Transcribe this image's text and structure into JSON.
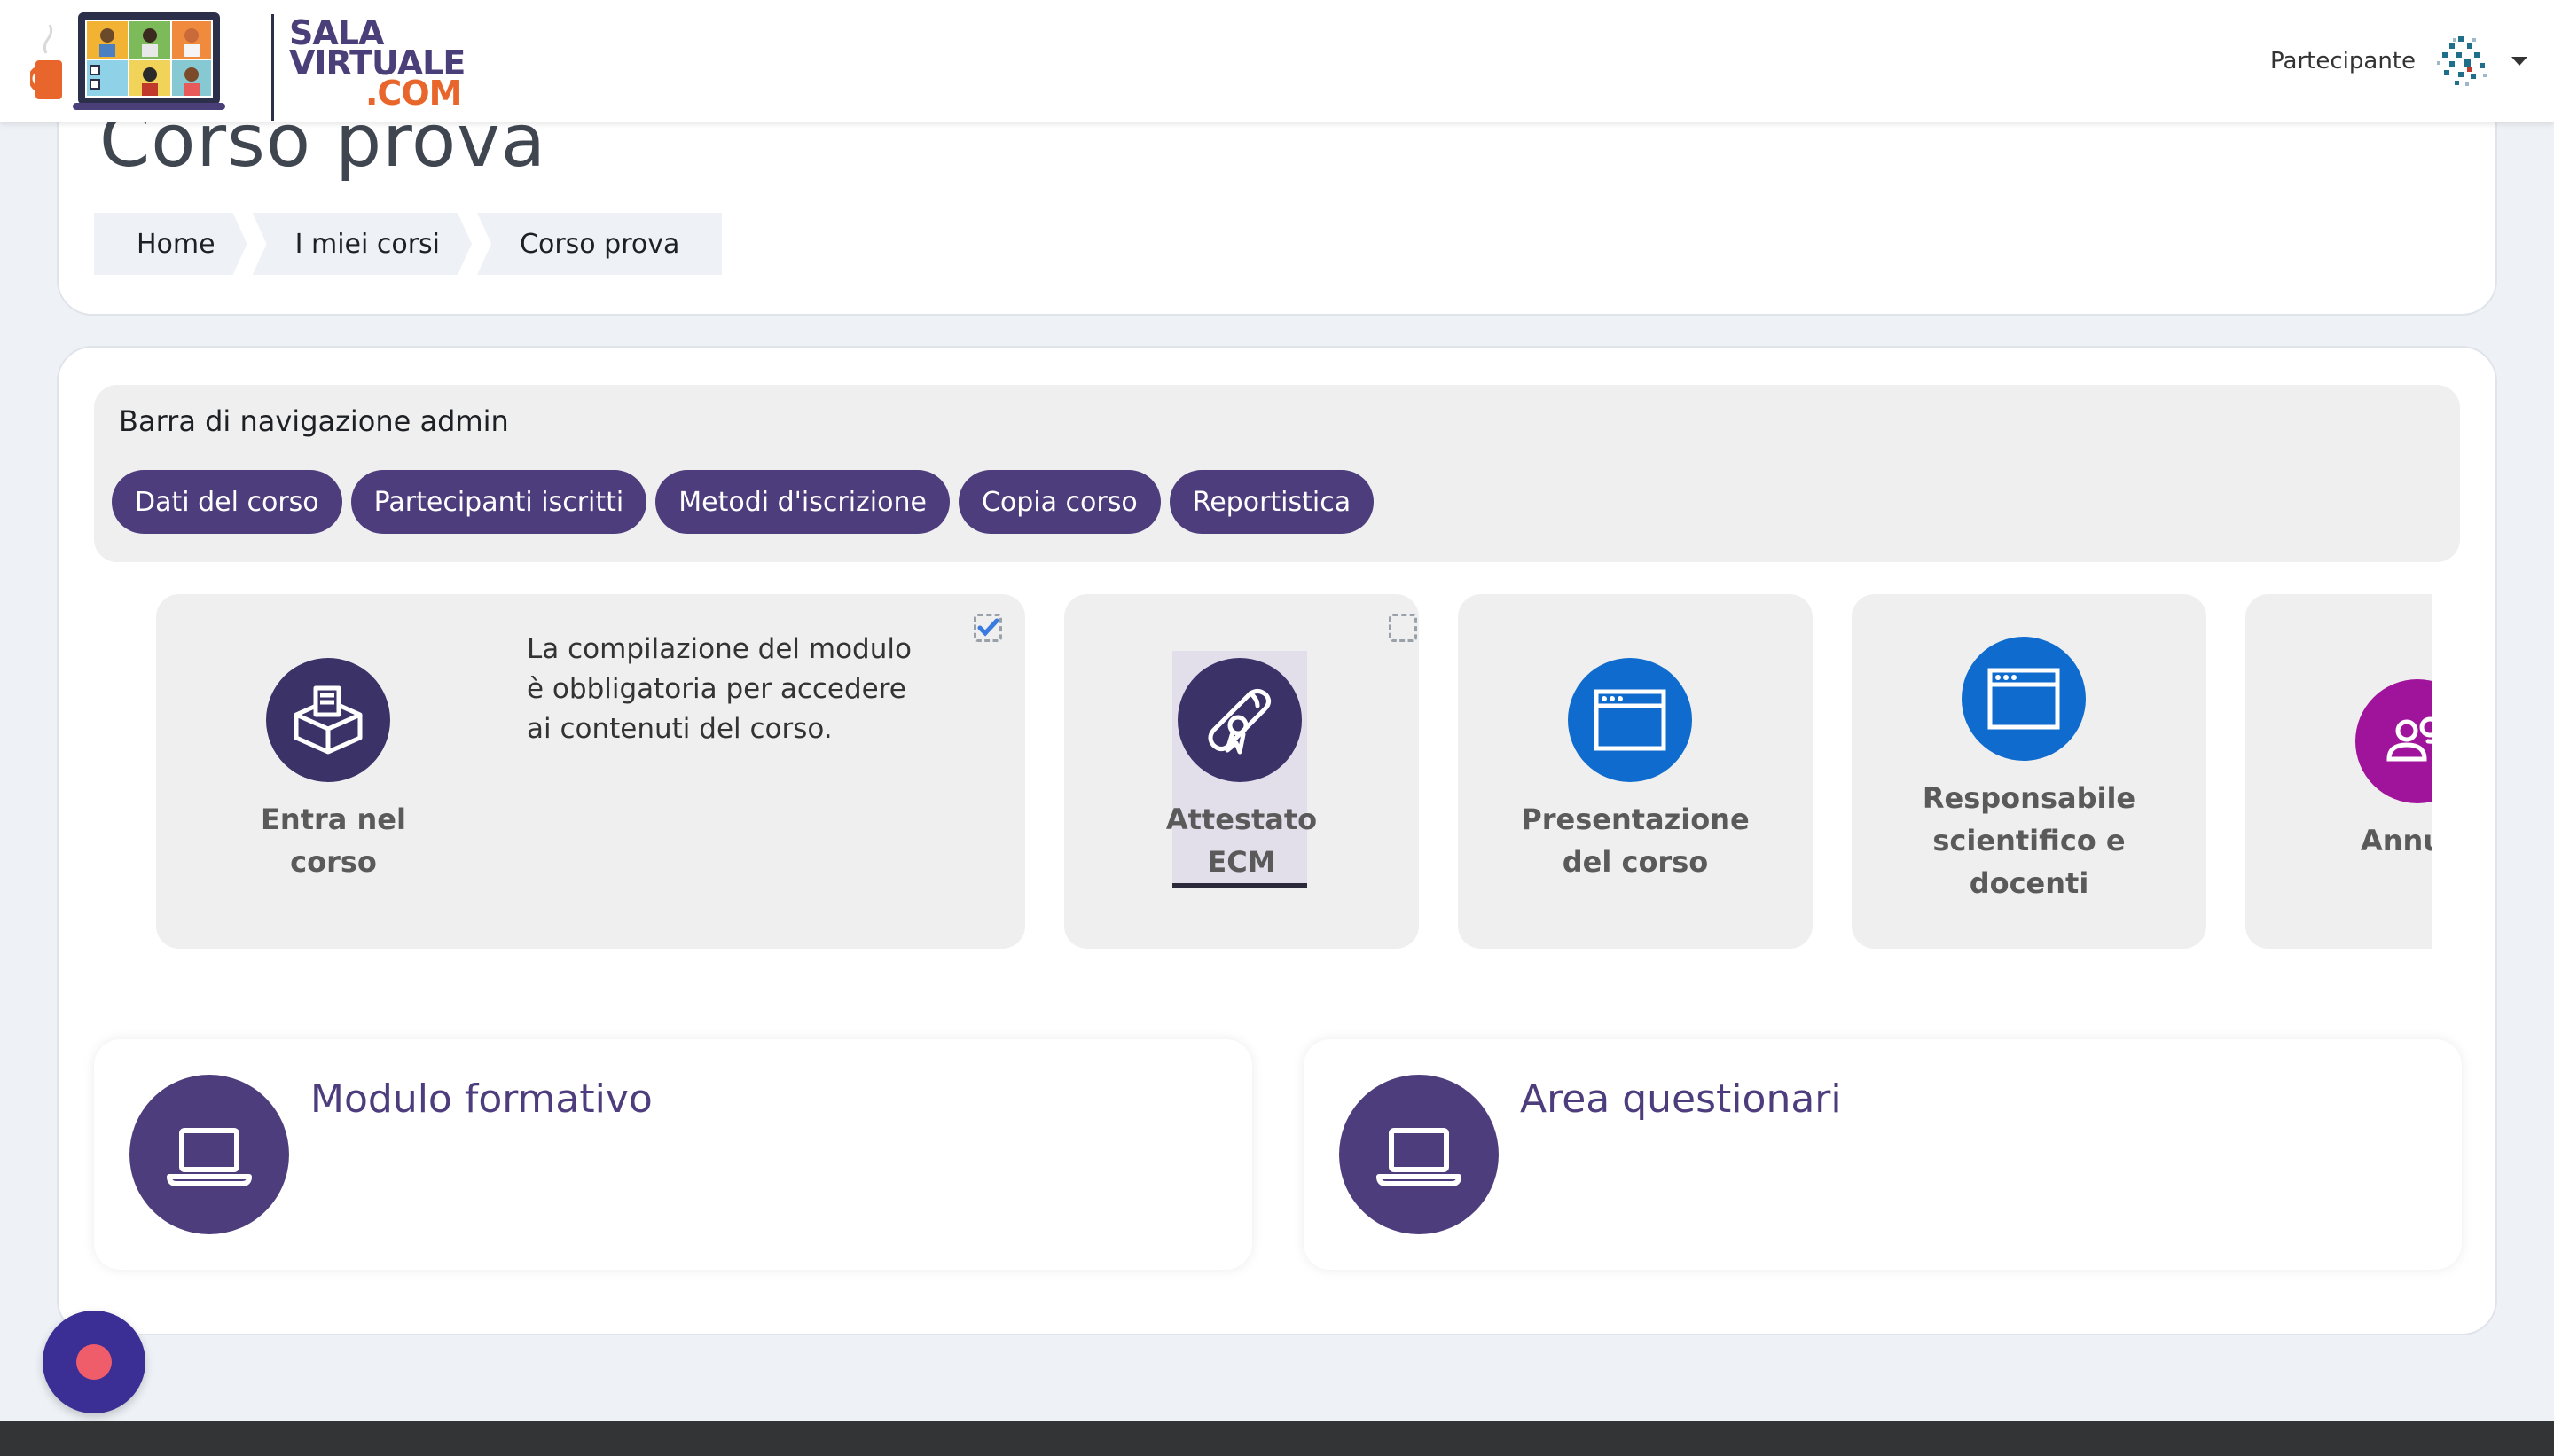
{
  "navbar": {
    "logo": {
      "line1": "SALA",
      "line2": "VIRTUALE",
      "line3": ".COM"
    },
    "user_role": "Partecipante"
  },
  "header": {
    "title": "Corso prova",
    "breadcrumb": [
      "Home",
      "I miei corsi",
      "Corso prova"
    ]
  },
  "admin_bar": {
    "title": "Barra di navigazione admin",
    "buttons": [
      "Dati del corso",
      "Partecipanti iscritti",
      "Metodi d'iscrizione",
      "Copia corso",
      "Reportistica"
    ]
  },
  "tiles": [
    {
      "label_line1": "Entra nel",
      "label_line2": "corso",
      "description": "La compilazione del modulo è obbligatoria per accedere ai contenuti del corso.",
      "completed": true,
      "icon": "ballot-box-icon",
      "color": "#3b3268"
    },
    {
      "label_line1": "Attestato",
      "label_line2": "ECM",
      "completed": false,
      "icon": "diploma-icon",
      "color": "#3b3268"
    },
    {
      "label_line1": "Presentazione",
      "label_line2": "del corso",
      "icon": "browser-window-icon",
      "color": "#0f6cce"
    },
    {
      "label_line1": "Responsabile",
      "label_line2": "scientifico e",
      "label_line3": "docenti",
      "icon": "browser-window-icon",
      "color": "#0f6cce"
    },
    {
      "label_line1": "Annu",
      "icon": "users-icon",
      "color": "#a0139b"
    }
  ],
  "sections": [
    {
      "title": "Modulo formativo",
      "icon": "laptop-icon"
    },
    {
      "title": "Area questionari",
      "icon": "laptop-icon"
    }
  ],
  "colors": {
    "primary": "#4d3d7d",
    "accent": "#e8662c",
    "tile_blue": "#0f6cce",
    "tile_magenta": "#a0139b"
  }
}
